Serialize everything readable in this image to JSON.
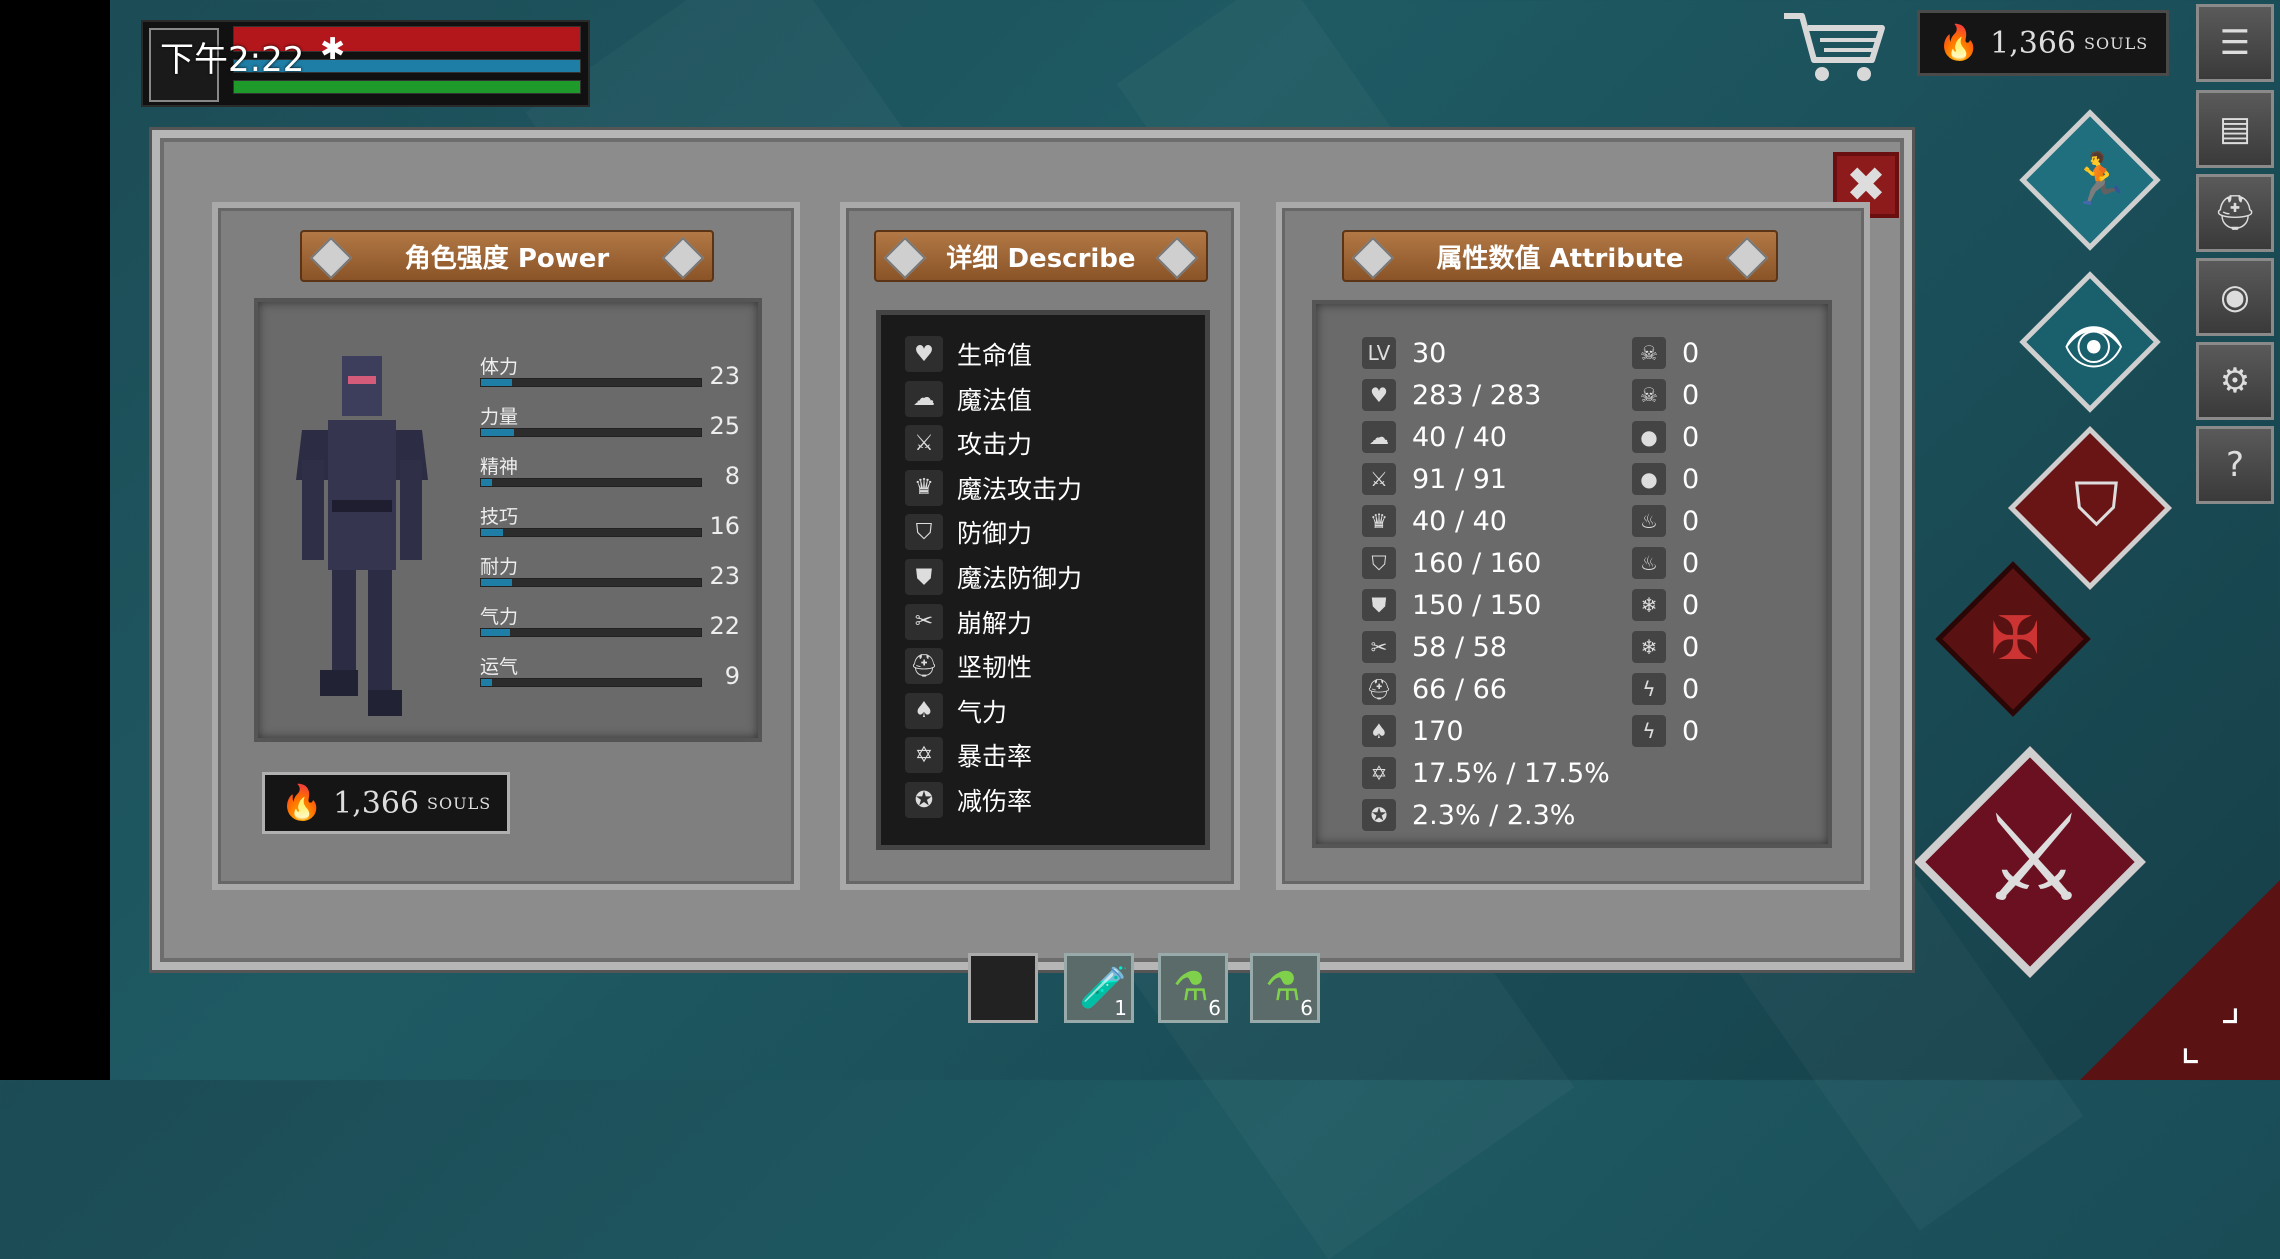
{
  "status": {
    "time": "下午2:22",
    "bluetooth": "✱"
  },
  "souls": {
    "top": "1,366",
    "panel": "1,366",
    "unit": "SOULS"
  },
  "side_menu": [
    "☰",
    "▤",
    "⛑",
    "◉",
    "⚙",
    "?"
  ],
  "panels": {
    "power": {
      "title": "角色强度 Power"
    },
    "describe": {
      "title": "详细 Describe"
    },
    "attribute": {
      "title": "属性数值 Attribute"
    }
  },
  "stats": [
    {
      "label": "体力",
      "value": "23",
      "fill": 0.14
    },
    {
      "label": "力量",
      "value": "25",
      "fill": 0.15
    },
    {
      "label": "精神",
      "value": "8",
      "fill": 0.05
    },
    {
      "label": "技巧",
      "value": "16",
      "fill": 0.1
    },
    {
      "label": "耐力",
      "value": "23",
      "fill": 0.14
    },
    {
      "label": "气力",
      "value": "22",
      "fill": 0.13
    },
    {
      "label": "运气",
      "value": "9",
      "fill": 0.05
    }
  ],
  "describe": [
    {
      "icon": "heart-icon",
      "glyph": "♥",
      "label": "生命值"
    },
    {
      "icon": "brain-icon",
      "glyph": "☁",
      "label": "魔法值"
    },
    {
      "icon": "sword-icon",
      "glyph": "⚔",
      "label": "攻击力"
    },
    {
      "icon": "magic-attack-icon",
      "glyph": "♛",
      "label": "魔法攻击力"
    },
    {
      "icon": "shield-icon",
      "glyph": "⛉",
      "label": "防御力"
    },
    {
      "icon": "magic-shield-icon",
      "glyph": "⛊",
      "label": "魔法防御力"
    },
    {
      "icon": "break-icon",
      "glyph": "✂",
      "label": "崩解力"
    },
    {
      "icon": "helmet-icon",
      "glyph": "⛑",
      "label": "坚韧性"
    },
    {
      "icon": "lungs-icon",
      "glyph": "♠",
      "label": "气力"
    },
    {
      "icon": "crit-icon",
      "glyph": "✡",
      "label": "暴击率"
    },
    {
      "icon": "reduce-icon",
      "glyph": "✪",
      "label": "减伤率"
    }
  ],
  "attributes_left": [
    {
      "icon": "level-icon",
      "glyph": "LV",
      "value": "30"
    },
    {
      "icon": "heart-icon",
      "glyph": "♥",
      "value": "283 / 283"
    },
    {
      "icon": "brain-icon",
      "glyph": "☁",
      "value": "40 / 40"
    },
    {
      "icon": "sword-icon",
      "glyph": "⚔",
      "value": "91 / 91"
    },
    {
      "icon": "magic-attack-icon",
      "glyph": "♛",
      "value": "40 / 40"
    },
    {
      "icon": "shield-icon",
      "glyph": "⛉",
      "value": "160 / 160"
    },
    {
      "icon": "magic-shield-icon",
      "glyph": "⛊",
      "value": "150 / 150"
    },
    {
      "icon": "break-icon",
      "glyph": "✂",
      "value": "58 / 58"
    },
    {
      "icon": "helmet-icon",
      "glyph": "⛑",
      "value": "66 / 66"
    },
    {
      "icon": "lungs-icon",
      "glyph": "♠",
      "value": "170"
    },
    {
      "icon": "crit-icon",
      "glyph": "✡",
      "value": "17.5% / 17.5%"
    },
    {
      "icon": "reduce-icon",
      "glyph": "✪",
      "value": "2.3% / 2.3%"
    }
  ],
  "attributes_right": [
    {
      "icon": "poison-skull-icon",
      "glyph": "☠",
      "value": "0"
    },
    {
      "icon": "poison-resist-icon",
      "glyph": "☠",
      "value": "0"
    },
    {
      "icon": "bleed-icon",
      "glyph": "●",
      "value": "0"
    },
    {
      "icon": "bleed-resist-icon",
      "glyph": "●",
      "value": "0"
    },
    {
      "icon": "fire-icon",
      "glyph": "♨",
      "value": "0"
    },
    {
      "icon": "fire-resist-icon",
      "glyph": "♨",
      "value": "0"
    },
    {
      "icon": "frost-icon",
      "glyph": "❄",
      "value": "0"
    },
    {
      "icon": "frost-resist-icon",
      "glyph": "❄",
      "value": "0"
    },
    {
      "icon": "lightning-icon",
      "glyph": "ϟ",
      "value": "0"
    },
    {
      "icon": "lightning-resist-icon",
      "glyph": "ϟ",
      "value": "0"
    }
  ],
  "items": [
    {
      "icon": "empty-slot",
      "count": ""
    },
    {
      "icon": "yellow-vial-icon",
      "count": "1"
    },
    {
      "icon": "green-flask-icon",
      "count": "6"
    },
    {
      "icon": "green-potion-icon",
      "count": "6"
    }
  ]
}
